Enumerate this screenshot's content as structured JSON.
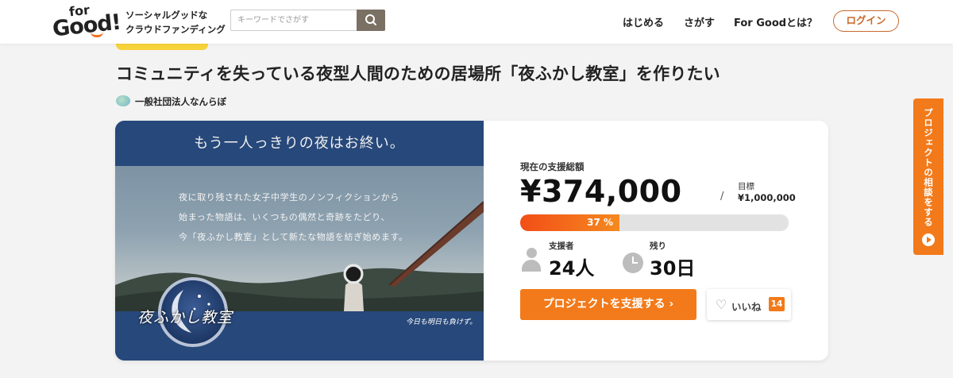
{
  "header": {
    "logo": {
      "line1": "for",
      "line2": "Good!"
    },
    "tagline": {
      "line1": "ソーシャルグッドな",
      "line2": "クラウドファンディング"
    },
    "search": {
      "placeholder": "キーワードでさがす",
      "icon": "search-icon"
    },
    "nav": [
      {
        "label": "はじめる"
      },
      {
        "label": "さがす"
      },
      {
        "label": "For Goodとは？"
      }
    ],
    "login_label": "ログイン"
  },
  "project": {
    "title": "コミュニティを失っている夜型人間のための居場所「夜ふかし教室」を作りたい",
    "organizer": "一般社団法人なんらぼ",
    "hero": {
      "headline": "もう一人っきりの夜はお終い。",
      "body": [
        "夜に取り残された女子中学生のノンフィクションから",
        "始まった物語は、いくつもの偶然と奇跡をたどり、",
        "今「夜ふかし教室」として新たな物語を紡ぎ始めます。"
      ],
      "emblem_text": "夜ふかし教室",
      "signature": "今日も明日も負けず。"
    }
  },
  "stats": {
    "total_label": "現在の支援総額",
    "total_amount": "¥374,000",
    "separator": "/",
    "goal_label": "目標",
    "goal_amount": "¥1,000,000",
    "progress_percent": 37,
    "progress_label": "37 %",
    "supporters_label": "支援者",
    "supporters_value": "24人",
    "remaining_label": "残り",
    "remaining_value": "30日"
  },
  "actions": {
    "support_label": "プロジェクトを支援する ›",
    "like_label": "いいね",
    "like_count": "14"
  },
  "side_tab": {
    "label": "プロジェクトの相談をする"
  },
  "colors": {
    "accent": "#f27a1a",
    "login_border": "#c8682c",
    "hero_navy": "#27487a",
    "badge_yellow": "#f7d23a"
  }
}
